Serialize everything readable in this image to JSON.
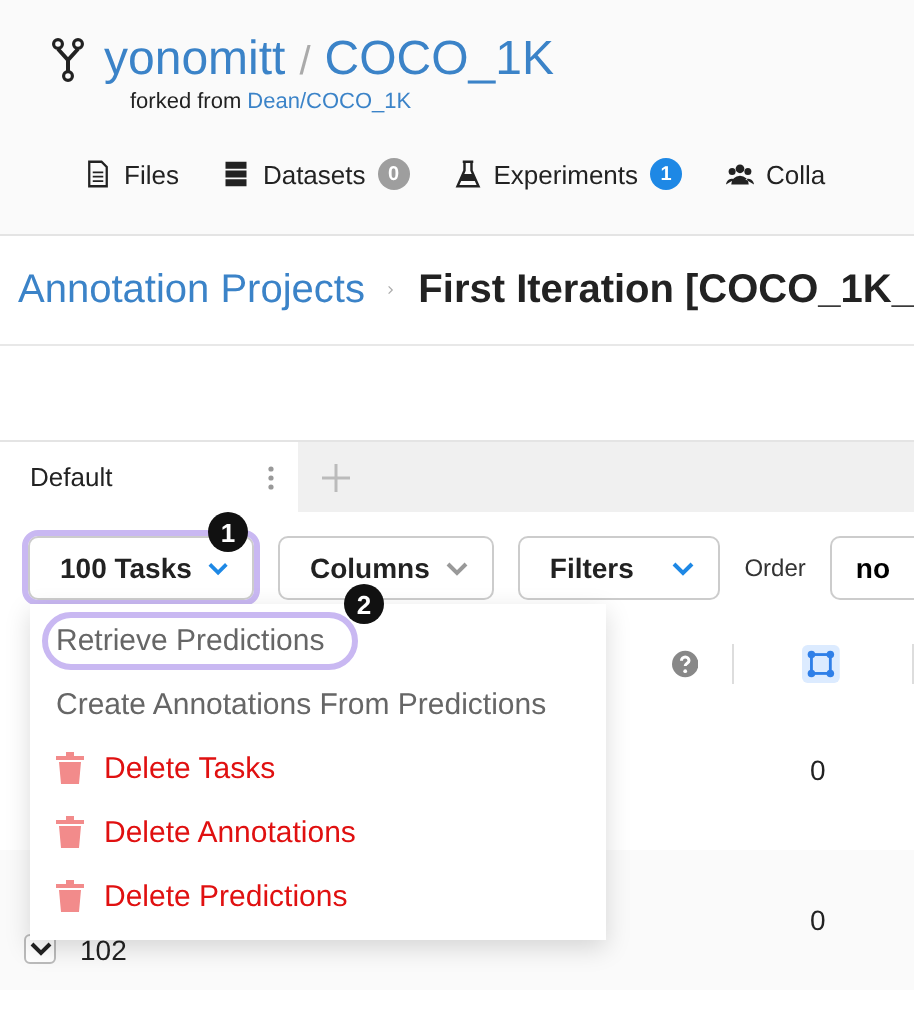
{
  "repo": {
    "owner": "yonomitt",
    "separator": "/",
    "name": "COCO_1K",
    "forked_label": "forked from",
    "forked_link": "Dean/COCO_1K"
  },
  "nav": [
    {
      "label": "Files",
      "kind": "file"
    },
    {
      "label": "Datasets",
      "kind": "dataset",
      "badge": "0",
      "color": "#9e9e9e"
    },
    {
      "label": "Experiments",
      "kind": "flask",
      "badge": "1",
      "color": "#1e88e5"
    },
    {
      "label": "Colla",
      "kind": "people"
    }
  ],
  "breadcrumb": {
    "parent": "Annotation Projects",
    "current": "First Iteration [COCO_1K_"
  },
  "tabs": [
    {
      "label": "Default",
      "selected": true
    }
  ],
  "toolbar": {
    "tasks": {
      "label": "100 Tasks",
      "highlighted": true,
      "callout": "1"
    },
    "columns": "Columns",
    "filters": "Filters",
    "order_label": "Order",
    "order_value": "no"
  },
  "menu": [
    {
      "label": "Retrieve Predictions",
      "kind": "plain",
      "highlighted": true,
      "callout": "2"
    },
    {
      "label": "Create Annotations From Predictions",
      "kind": "plain",
      "highlighted": false
    },
    {
      "label": "Delete Tasks",
      "kind": "danger",
      "highlighted": false
    },
    {
      "label": "Delete Annotations",
      "kind": "danger",
      "highlighted": false
    },
    {
      "label": "Delete Predictions",
      "kind": "danger",
      "highlighted": false
    }
  ],
  "rows": [
    {
      "value": "0"
    },
    {
      "id": "102",
      "value": "0"
    }
  ]
}
